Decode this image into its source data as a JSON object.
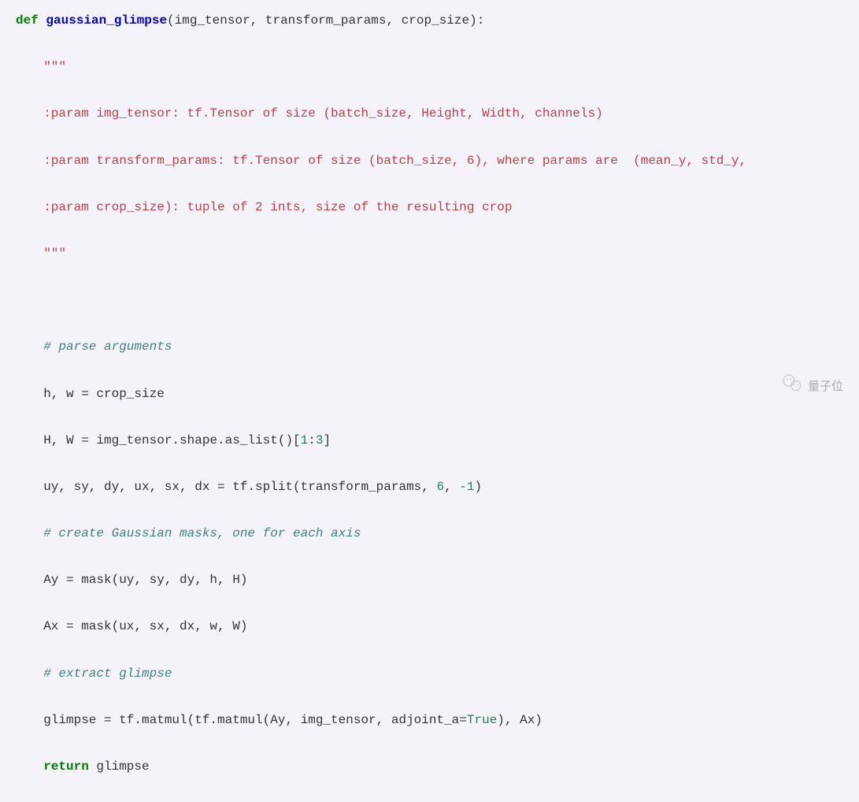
{
  "code": {
    "line1_kw": "def",
    "line1_fn": "gaussian_glimpse",
    "line1_rest": "(img_tensor, transform_params, crop_size):",
    "line2": "\"\"\"",
    "line3": ":param img_tensor: tf.Tensor of size (batch_size, Height, Width, channels)",
    "line4": ":param transform_params: tf.Tensor of size (batch_size, 6), where params are  (mean_y, std_y,",
    "line5": ":param crop_size): tuple of 2 ints, size of the resulting crop",
    "line6": "\"\"\"",
    "line7": "# parse arguments",
    "line8": "h, w = crop_size",
    "line9a": "H, W = img_tensor.shape.as_list()[",
    "line9_num1": "1",
    "line9_colon": ":",
    "line9_num2": "3",
    "line9b": "]",
    "line10a": "uy, sy, dy, ux, sx, dx = tf.split(transform_params, ",
    "line10_num1": "6",
    "line10_mid": ", ",
    "line10_num2": "-1",
    "line10b": ")",
    "line11": "# create Gaussian masks, one for each axis",
    "line12": "Ay = mask(uy, sy, dy, h, H)",
    "line13": "Ax = mask(ux, sx, dx, w, W)",
    "line14": "# extract glimpse",
    "line15a": "glimpse = tf.matmul(tf.matmul(Ay, img_tensor, adjoint_a=",
    "line15_const": "True",
    "line15b": "), Ax)",
    "line16_kw": "return",
    "line16_rest": " glimpse"
  },
  "watermark": {
    "text": "量子位"
  }
}
